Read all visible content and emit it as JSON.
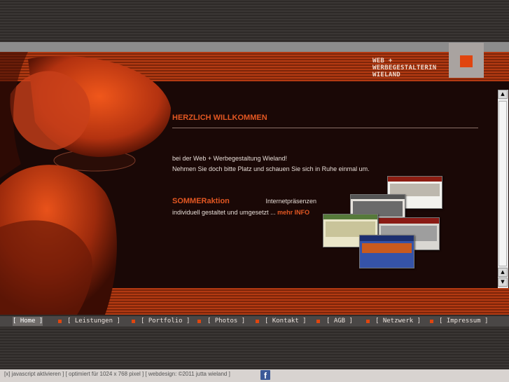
{
  "brand": {
    "line1": "WEB +",
    "line2": "WERBEGESTALTERIN",
    "line3": "WIELAND",
    "accent_color": "#e0450f"
  },
  "content": {
    "title": "HERZLICH WILLKOMMEN",
    "intro_line1": "bei der Web + Werbegestaltung Wieland!",
    "intro_line2": "Nehmen Sie doch bitte Platz und schauen Sie sich in Ruhe einmal um.",
    "promo_highlight": "SOMMERaktion",
    "promo_text1": "Internetpräsenzen",
    "promo_text2": "individuell gestaltet und umgesetzt ...",
    "promo_more": "mehr INFO"
  },
  "nav": {
    "items": [
      {
        "label": "[ Home ]"
      },
      {
        "label": "[ Leistungen ]"
      },
      {
        "label": "[ Portfolio ]"
      },
      {
        "label": "[ Photos ]"
      },
      {
        "label": "[ Kontakt ]"
      },
      {
        "label": "[ AGB ]"
      },
      {
        "label": "[ Netzwerk ]"
      },
      {
        "label": "[ Impressum ]"
      }
    ],
    "active": "Home"
  },
  "footer": {
    "text": "[x] javascript aktivieren ] [ optimiert für 1024 x 768 pixel ] [ webdesign: ©2011 jutta wieland ]",
    "social_icon": "facebook-icon"
  },
  "scrollbar": {
    "up_icon": "arrow-up-icon",
    "down_icon": "arrow-down-icon"
  }
}
